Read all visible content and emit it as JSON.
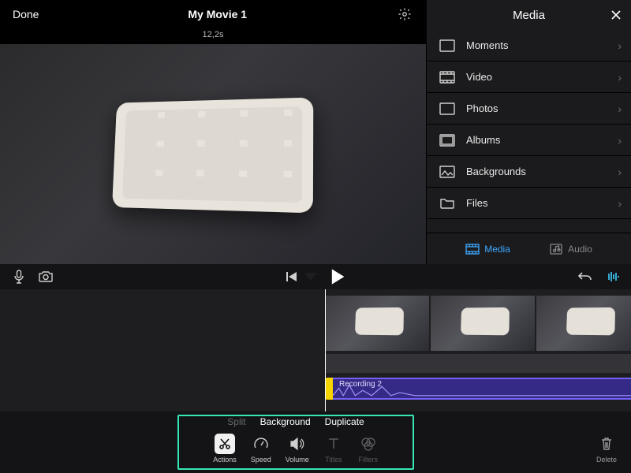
{
  "header": {
    "done_label": "Done",
    "title": "My Movie 1",
    "timecode": "12,2s"
  },
  "media_panel": {
    "title": "Media",
    "items": [
      {
        "label": "Moments",
        "icon": "moments"
      },
      {
        "label": "Video",
        "icon": "video"
      },
      {
        "label": "Photos",
        "icon": "photos"
      },
      {
        "label": "Albums",
        "icon": "albums"
      },
      {
        "label": "Backgrounds",
        "icon": "backgrounds"
      },
      {
        "label": "Files",
        "icon": "files"
      }
    ],
    "tabs": {
      "media": "Media",
      "audio": "Audio",
      "active": "media"
    }
  },
  "timeline": {
    "audio_clip_label": "Recording 2"
  },
  "bottom": {
    "context_actions": {
      "split": "Split",
      "background": "Background",
      "duplicate": "Duplicate"
    },
    "tools": {
      "actions": "Actions",
      "speed": "Speed",
      "volume": "Volume",
      "titles": "Titles",
      "filters": "Filters"
    },
    "delete_label": "Delete"
  }
}
